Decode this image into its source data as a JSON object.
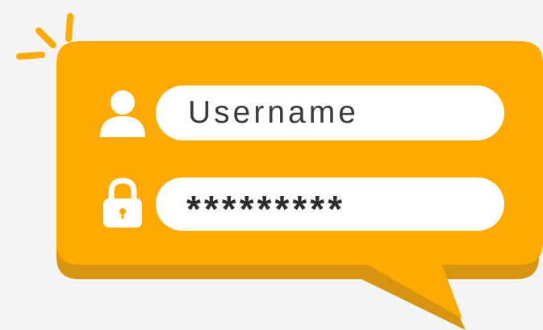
{
  "login_card": {
    "username_placeholder": "Username",
    "password_mask": "*********"
  },
  "icons": {
    "user": "user-icon",
    "lock": "lock-icon",
    "spark": "spark-icon"
  },
  "colors": {
    "background": "#f4f4f4",
    "bubble": "#ffaa00",
    "bubble_shadow": "#d6940f",
    "field": "#ffffff",
    "icon": "#ffffff",
    "text": "#3b3b3b"
  }
}
